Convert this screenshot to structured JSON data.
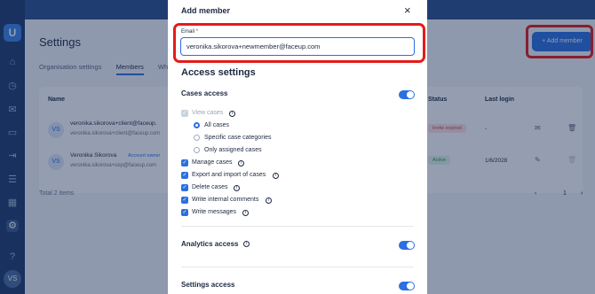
{
  "sidebar": {
    "logo": "U",
    "avatar": "VS"
  },
  "page": {
    "title": "Settings",
    "tabs": [
      "Organisation settings",
      "Members",
      "Whi"
    ],
    "add_member_button": "+ Add member"
  },
  "table": {
    "headers": [
      "Name",
      "Status",
      "Last login"
    ],
    "rows": [
      {
        "initials": "VS",
        "name": "veronika.sikorova+client@faceup.",
        "email": "veronika.sikorova+client@faceup.com",
        "status": "Invite expired",
        "last_login": "-"
      },
      {
        "initials": "VS",
        "name": "Veronika Sikorova",
        "role": "Account owner",
        "email": "veronika.sikorova+usp@faceup.com",
        "status": "Active",
        "last_login": "1/6/2028"
      }
    ],
    "total": "Total 2 items",
    "page_prev": "‹",
    "page_number": "1",
    "page_next": "›"
  },
  "modal": {
    "title": "Add member",
    "close_icon": "×",
    "email_label": "Email",
    "email_required": "*",
    "email_value": "veronika.sikorova+newmember@faceup.com",
    "access_settings": "Access settings",
    "cases_access": "Cases access",
    "view_cases": "View cases",
    "radio_all": "All cases",
    "radio_specific": "Specific case categories",
    "radio_assigned": "Only assigned cases",
    "manage_cases": "Manage cases",
    "export_import": "Export and import of cases",
    "delete_cases": "Delete cases",
    "write_internal": "Write internal comments",
    "write_messages": "Write messages",
    "analytics_access": "Analytics access",
    "settings_access": "Settings access"
  },
  "colors": {
    "accent": "#2b6fe0",
    "highlight": "#e41b17",
    "sidebar": "#1d3a6b"
  }
}
